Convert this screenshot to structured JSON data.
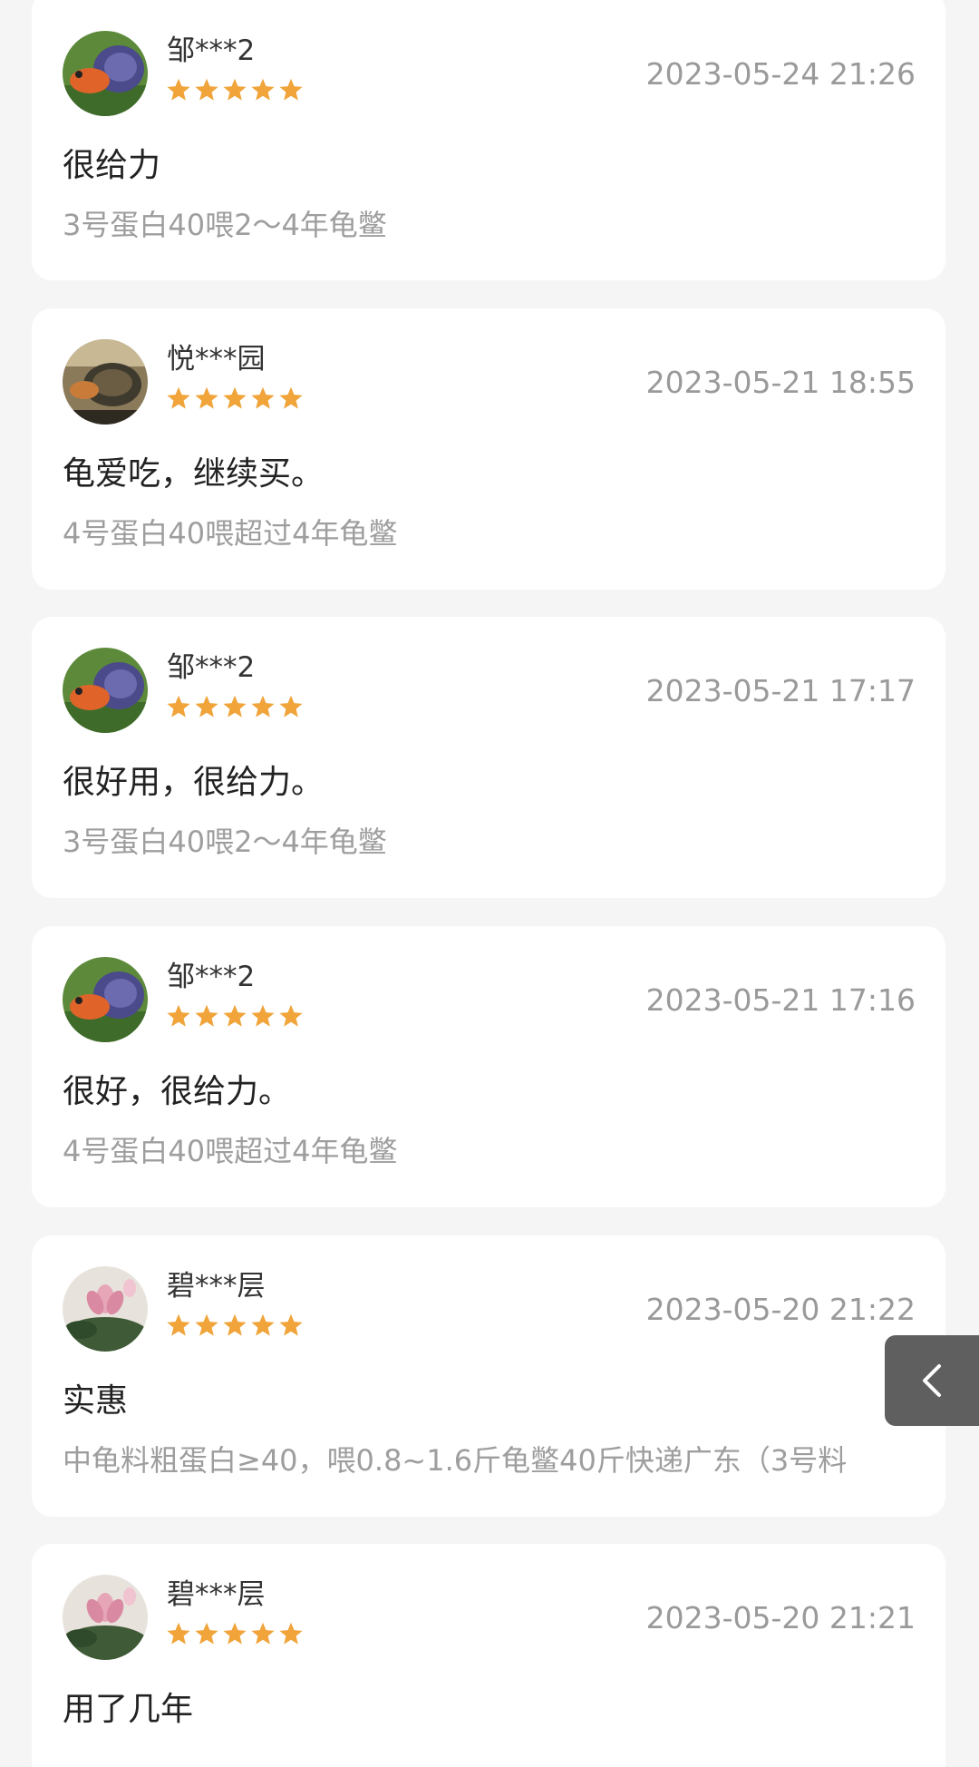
{
  "colors": {
    "page_background": "#f5f5f5",
    "card_background": "#ffffff",
    "star": "#f0a43a",
    "back_tab": "#5f5f5f"
  },
  "reviews": [
    {
      "username": "邹***2",
      "avatar": "turtle-avatar-green",
      "rating": 5,
      "timestamp": "2023-05-24 21:26",
      "text": "很给力",
      "spec": "3号蛋白40喂2～4年龟鳖"
    },
    {
      "username": "悦***园",
      "avatar": "turtle-avatar-brown",
      "rating": 5,
      "timestamp": "2023-05-21 18:55",
      "text": "龟爱吃，继续买。",
      "spec": "4号蛋白40喂超过4年龟鳖"
    },
    {
      "username": "邹***2",
      "avatar": "turtle-avatar-green",
      "rating": 5,
      "timestamp": "2023-05-21 17:17",
      "text": "很好用，很给力。",
      "spec": "3号蛋白40喂2～4年龟鳖"
    },
    {
      "username": "邹***2",
      "avatar": "turtle-avatar-green",
      "rating": 5,
      "timestamp": "2023-05-21 17:16",
      "text": "很好，很给力。",
      "spec": "4号蛋白40喂超过4年龟鳖"
    },
    {
      "username": "碧***层",
      "avatar": "lotus-avatar",
      "rating": 5,
      "timestamp": "2023-05-20 21:22",
      "text": "实惠",
      "spec": "中龟料粗蛋白≥40，喂0.8~1.6斤龟鳖40斤快递广东（3号料"
    },
    {
      "username": "碧***层",
      "avatar": "lotus-avatar",
      "rating": 5,
      "timestamp": "2023-05-20 21:21",
      "text": "用了几年",
      "spec": ""
    }
  ],
  "back_button": {
    "icon": "chevron-left-icon"
  }
}
